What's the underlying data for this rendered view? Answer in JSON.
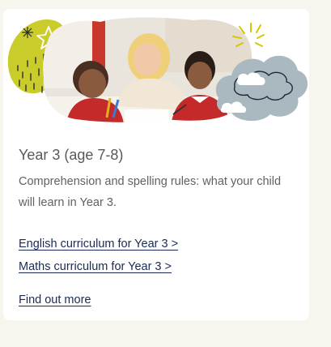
{
  "card": {
    "title": "Year 3 (age 7-8)",
    "description": "Comprehension and spelling rules: what your child will learn in Year 3.",
    "links": [
      {
        "label": "English curriculum for Year 3 >"
      },
      {
        "label": "Maths curriculum for Year 3 >"
      }
    ],
    "find_out_more": "Find out more"
  },
  "colors": {
    "background": "#f7f5ee",
    "card": "#ffffff",
    "link": "#1a2a55",
    "title": "#555a5f",
    "accent_yellow": "#c9cc2a",
    "cloud_grey": "#aab8bf"
  },
  "icons": [
    "sparkle-star-icon",
    "sun-rays-icon",
    "rain-drops-icon",
    "cloud-icon"
  ]
}
